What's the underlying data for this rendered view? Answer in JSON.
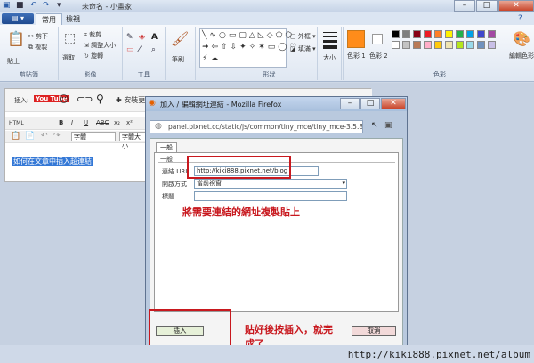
{
  "paint": {
    "title": "未命名 - 小畫家",
    "tabs": [
      "常用",
      "檢視"
    ],
    "groups": {
      "clipboard": {
        "label": "剪貼簿",
        "paste": "貼上",
        "cut": "剪下",
        "copy": "複製"
      },
      "image": {
        "label": "影像",
        "select": "選取",
        "crop": "裁剪",
        "resize": "調整大小",
        "rotate": "旋轉"
      },
      "tools": {
        "label": "工具"
      },
      "brushes": {
        "label": "筆刷"
      },
      "shapes": {
        "label": "形狀",
        "outline": "外框",
        "fill": "填滿"
      },
      "size": {
        "label": "大小"
      },
      "colors": {
        "label": "色彩",
        "color1": "色彩 1",
        "color2": "色彩 2",
        "edit": "編輯色彩"
      }
    },
    "palette": [
      "#000000",
      "#7f7f7f",
      "#880015",
      "#ed1c24",
      "#ff7f27",
      "#fff200",
      "#22b14c",
      "#00a2e8",
      "#3f48cc",
      "#a349a4",
      "#ffffff",
      "#c3c3c3",
      "#b97a57",
      "#ffaec9",
      "#ffc90e",
      "#efe4b0",
      "#b5e61d",
      "#99d9ea",
      "#7092be",
      "#c8bfe7"
    ]
  },
  "editor": {
    "insert_label": "插入:",
    "youtube": "You Tube",
    "more": "安裝更多...",
    "font_select": "字體",
    "size_select": "字體大小",
    "highlighted_text": "如何在文章中插入超連結"
  },
  "firefox": {
    "title": "加入 / 編輯網址連結 - Mozilla Firefox",
    "url": "panel.pixnet.cc/static/js/common/tiny_mce/tiny_mce-3.5.8/jscrip",
    "tab_general": "一般",
    "section_general": "一般",
    "label_url": "連結 URL",
    "value_url": "http://kiki888.pixnet.net/blog",
    "label_target": "開啟方式",
    "value_target": "當前視窗",
    "label_title": "標題",
    "insert_button": "插入",
    "cancel_button": "取消"
  },
  "annotations": {
    "paste_note": "將需要連結的網址複製貼上",
    "insert_note_line1": "貼好後按插入，就完",
    "insert_note_line2": "成了"
  },
  "watermark": "http://kiki888.pixnet.net/album"
}
